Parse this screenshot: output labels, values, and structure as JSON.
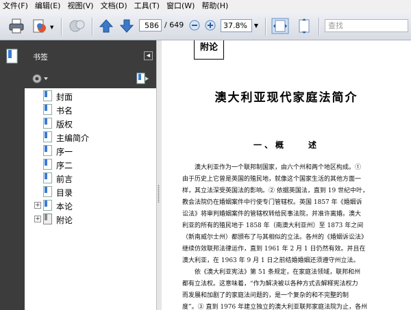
{
  "menu": [
    {
      "label": "文件(F)"
    },
    {
      "label": "编辑(E)"
    },
    {
      "label": "视图(V)"
    },
    {
      "label": "文档(D)"
    },
    {
      "label": "工具(T)"
    },
    {
      "label": "窗口(W)"
    },
    {
      "label": "帮助(H)"
    }
  ],
  "toolbar": {
    "page_current": "586",
    "page_total": "/ 649",
    "zoom": "37.8%",
    "search_placeholder": "查找"
  },
  "panel": {
    "title": "书签",
    "bookmarks": [
      {
        "label": "封面"
      },
      {
        "label": "书名"
      },
      {
        "label": "版权"
      },
      {
        "label": "主编简介"
      },
      {
        "label": "序一"
      },
      {
        "label": "序二"
      },
      {
        "label": "前言"
      },
      {
        "label": "目录"
      },
      {
        "label": "本论"
      },
      {
        "label": "附论"
      }
    ]
  },
  "doc": {
    "label": "附论",
    "title": "澳大利亚现代家庭法简介",
    "section": "一、概　　述",
    "lines": [
      "　　澳大利亚作为一个联邦制国家，由六个州和两个地区构成。①",
      "由于历史上它曾是英国的殖民地，就像这个国家生活的其他方面一",
      "样，其立法深受英国法的影响。② 依据英国法，直到 19 世纪中叶，",
      "教会法院仍在婚姻案件中行使专门管辖权。英国 1857 年《婚姻诉",
      "讼法》将审判婚姻案件的管辖权转给民事法院，并准许离婚。澳大",
      "利亚的所有的殖民地于 1858 年（南澳大利亚州）至 1873 年之间",
      "（新南威尔士州）都颁布了与其相似的立法。各州的《婚姻诉讼法》",
      "继续仿效联邦法律运作，直到 1961 年 2 月 1 日仍然有效。并且在",
      "澳大利亚，在 1963 年 9 月 1 日之前结婚婚姻还须遵守州立法。",
      "　　依《澳大利亚宪法》第 51 条规定，在家庭法领域，联邦和州",
      "都有立法权。这意味着，“作为解决被以各种方式去解释宪法权力",
      "而发展和加剧了的家庭法问题的，是一个复杂的和不完整的制",
      "度”。③ 直到 1976 年建立独立的澳大利亚联邦家庭法院为止，各州"
    ]
  }
}
